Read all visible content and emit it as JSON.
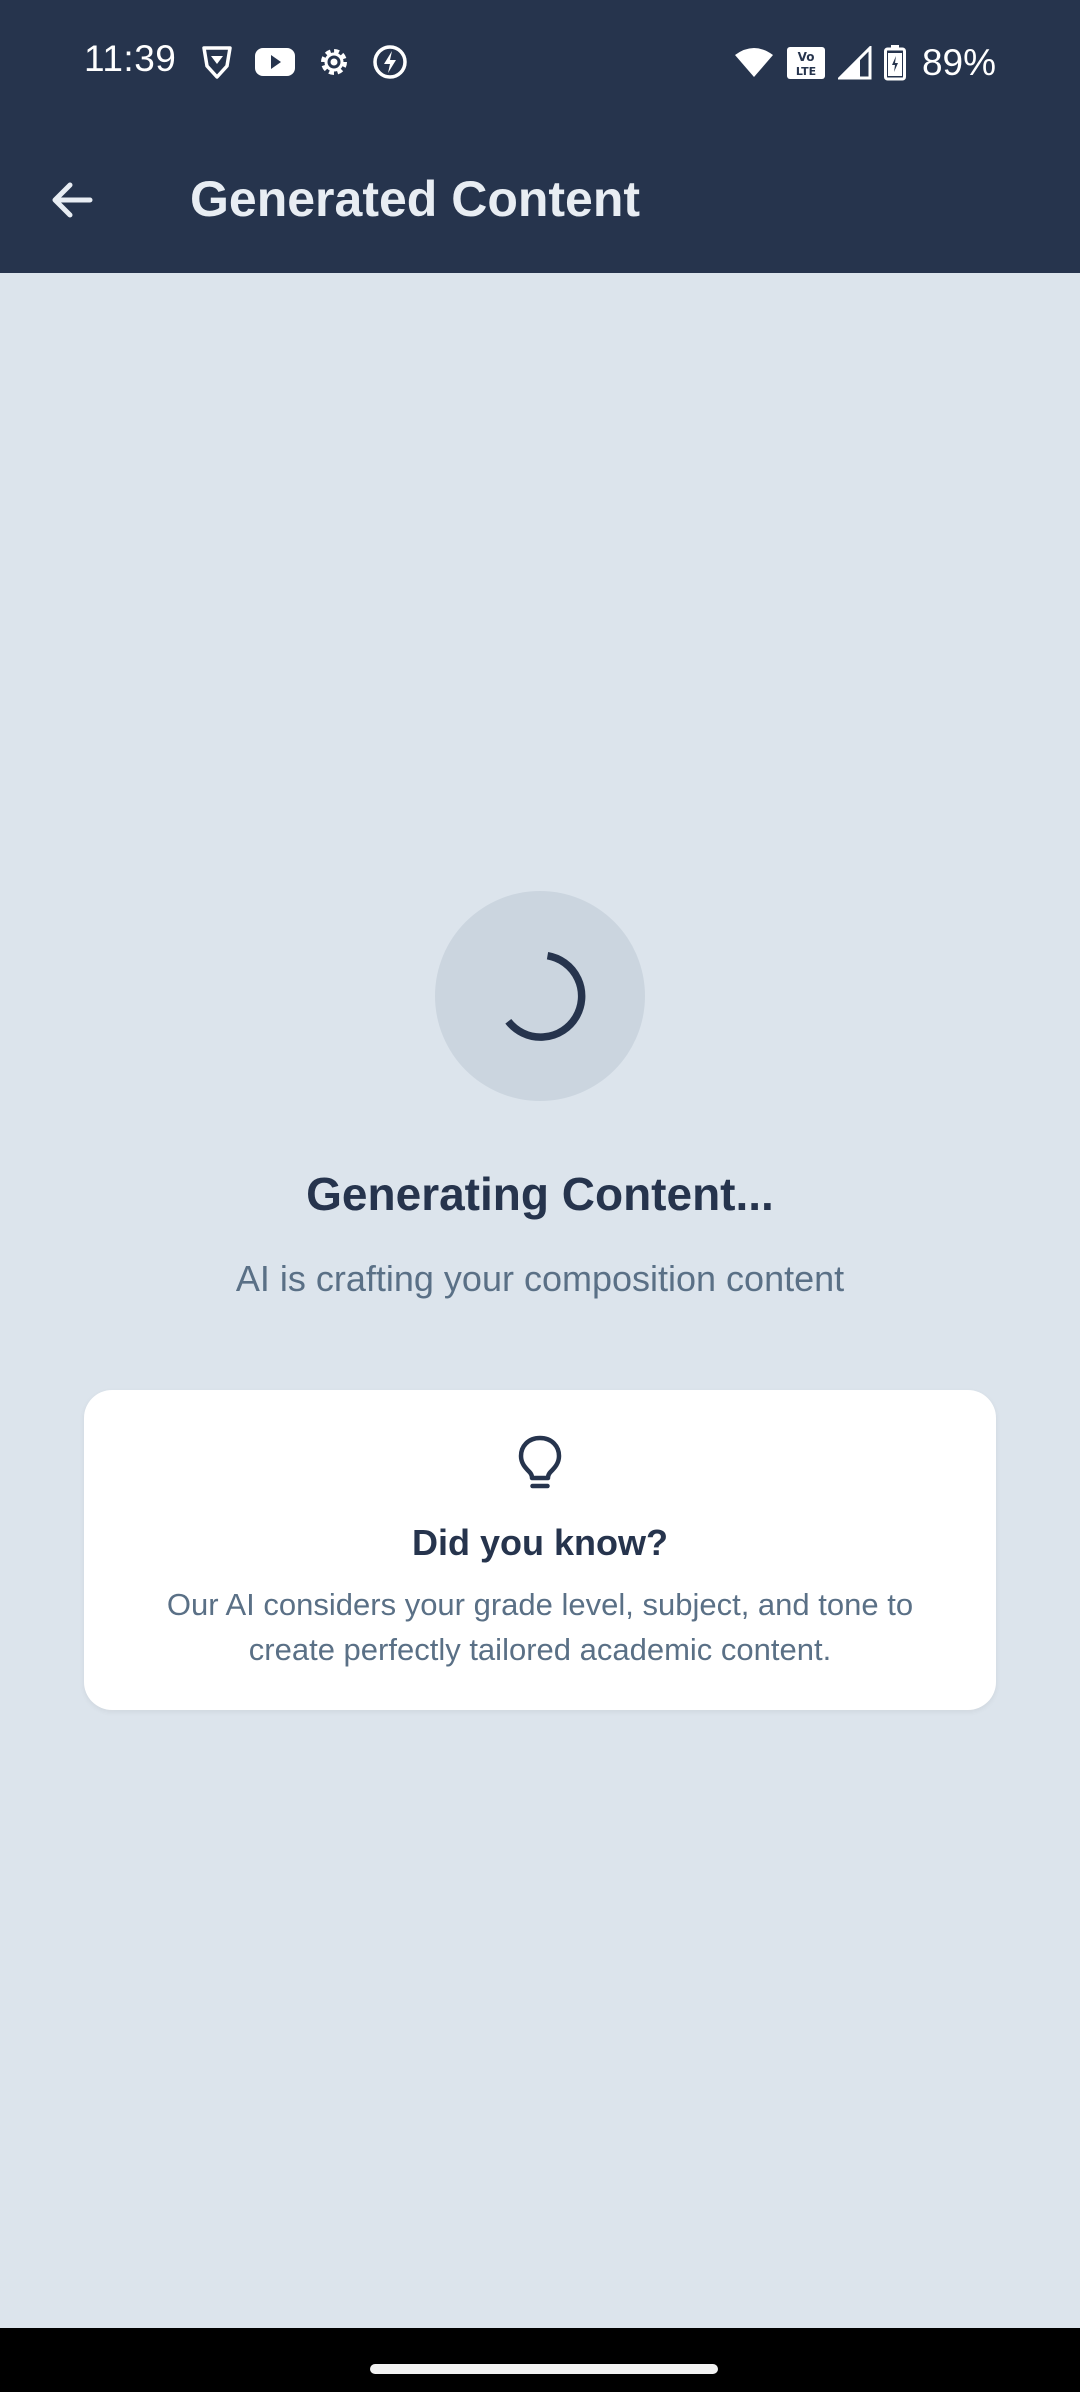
{
  "status_bar": {
    "time": "11:39",
    "battery_percent": "89%",
    "left_icons": [
      "brave-icon",
      "youtube-icon",
      "settings-icon",
      "flash-icon"
    ],
    "right_icons": [
      "wifi-icon",
      "volte-icon",
      "signal-icon",
      "battery-icon"
    ],
    "volte_label": "Vo LTE"
  },
  "app_bar": {
    "title": "Generated Content",
    "back_icon": "arrow-back-icon"
  },
  "loading": {
    "title": "Generating Content...",
    "subtitle": "AI is crafting your composition content"
  },
  "tip_card": {
    "icon": "lightbulb-icon",
    "title": "Did you know?",
    "body": "Our AI considers your grade level, subject, and tone to create perfectly tailored academic content."
  },
  "colors": {
    "header": "#26344d",
    "background": "#dce4ec",
    "card": "#ffffff",
    "text_dark": "#26344d",
    "text_muted": "#5a7086"
  }
}
